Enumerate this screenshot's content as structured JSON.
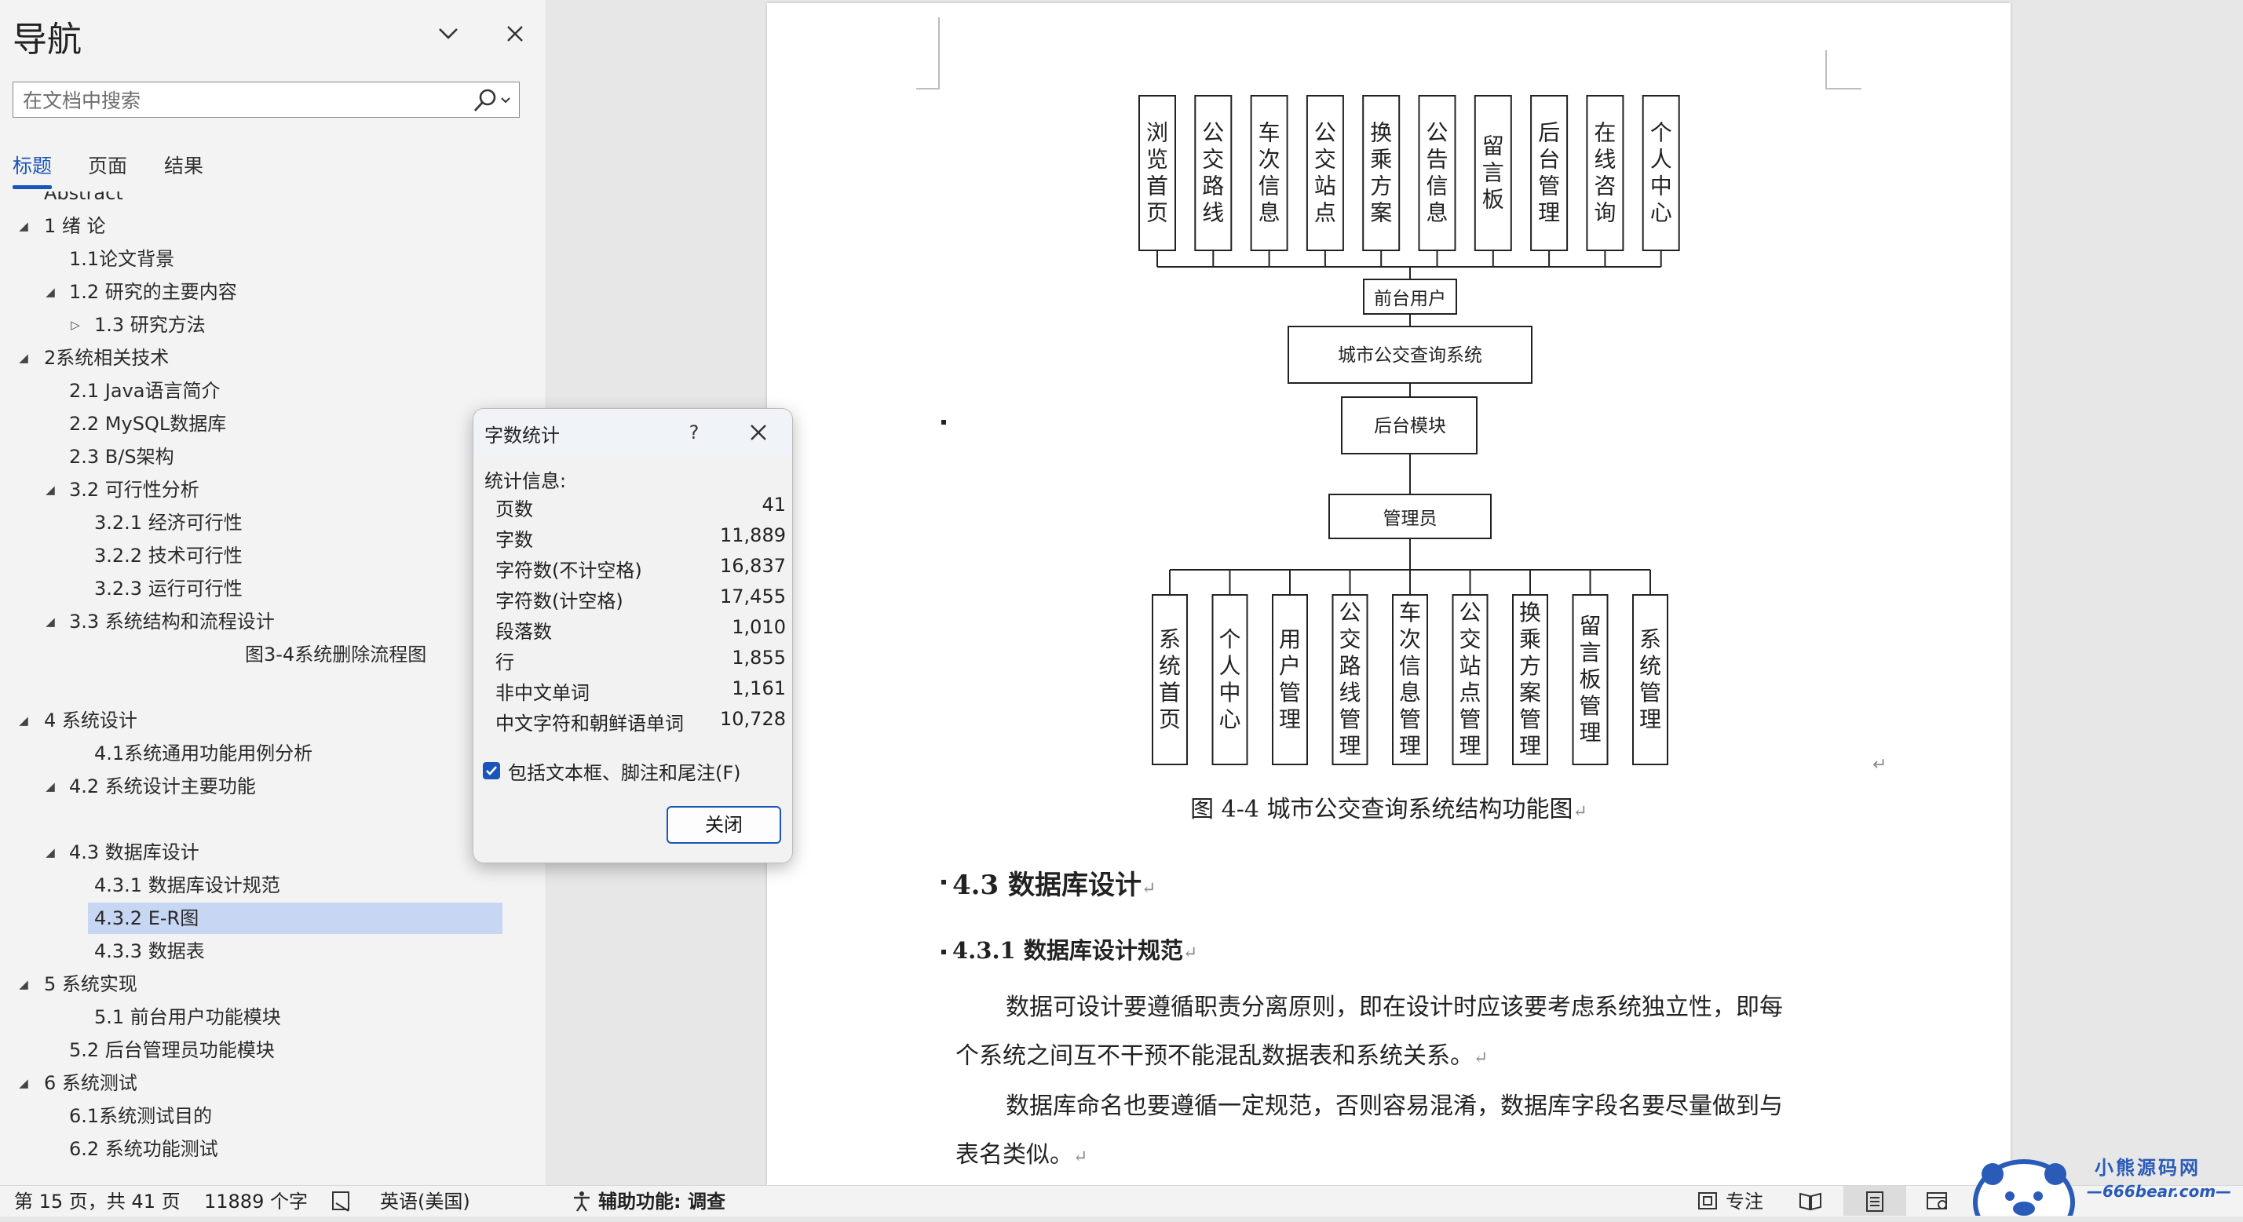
{
  "nav": {
    "title": "导航",
    "search_placeholder": "在文档中搜索",
    "tabs": [
      "标题",
      "页面",
      "结果"
    ],
    "items": [
      {
        "label": "Abstract",
        "level": 1,
        "arrow": ""
      },
      {
        "label": "1 绪  论",
        "level": 1,
        "arrow": "expanded"
      },
      {
        "label": "1.1论文背景",
        "level": 2,
        "arrow": ""
      },
      {
        "label": "1.2 研究的主要内容",
        "level": 2,
        "arrow": "expanded"
      },
      {
        "label": "1.3 研究方法",
        "level": 3,
        "arrow": "collapsed"
      },
      {
        "label": "2系统相关技术",
        "level": 1,
        "arrow": "expanded"
      },
      {
        "label": "2.1 Java语言简介",
        "level": 2,
        "arrow": ""
      },
      {
        "label": "2.2  MySQL数据库",
        "level": 2,
        "arrow": ""
      },
      {
        "label": "2.3 B/S架构",
        "level": 2,
        "arrow": ""
      },
      {
        "label": "3.2 可行性分析",
        "level": 2,
        "arrow": "expanded"
      },
      {
        "label": "3.2.1 经济可行性",
        "level": 3,
        "arrow": ""
      },
      {
        "label": "3.2.2 技术可行性",
        "level": 3,
        "arrow": ""
      },
      {
        "label": "3.2.3 运行可行性",
        "level": 3,
        "arrow": ""
      },
      {
        "label": "3.3 系统结构和流程设计",
        "level": 2,
        "arrow": "expanded"
      },
      {
        "label": "图3-4系统删除流程图",
        "level": 6,
        "arrow": ""
      },
      {
        "label": "",
        "level": 1,
        "arrow": ""
      },
      {
        "label": "4 系统设计",
        "level": 1,
        "arrow": "expanded"
      },
      {
        "label": "4.1系统通用功能用例分析",
        "level": 3,
        "arrow": ""
      },
      {
        "label": "4.2 系统设计主要功能",
        "level": 2,
        "arrow": "expanded"
      },
      {
        "label": "",
        "level": 1,
        "arrow": ""
      },
      {
        "label": "4.3 数据库设计",
        "level": 2,
        "arrow": "expanded"
      },
      {
        "label": "4.3.1 数据库设计规范",
        "level": 3,
        "arrow": ""
      },
      {
        "label": "4.3.2 E-R图",
        "level": 3,
        "arrow": "",
        "selected": true
      },
      {
        "label": "4.3.3 数据表",
        "level": 3,
        "arrow": ""
      },
      {
        "label": "5 系统实现",
        "level": 1,
        "arrow": "expanded"
      },
      {
        "label": "5.1 前台用户功能模块",
        "level": 3,
        "arrow": ""
      },
      {
        "label": "5.2 后台管理员功能模块",
        "level": 2,
        "arrow": ""
      },
      {
        "label": "6 系统测试",
        "level": 1,
        "arrow": "expanded"
      },
      {
        "label": "6.1系统测试目的",
        "level": 2,
        "arrow": ""
      },
      {
        "label": "6.2 系统功能测试",
        "level": 2,
        "arrow": ""
      }
    ]
  },
  "dialog": {
    "title": "字数统计",
    "help": "?",
    "section": "统计信息:",
    "stats": [
      {
        "label": "页数",
        "value": "41"
      },
      {
        "label": "字数",
        "value": "11,889"
      },
      {
        "label": "字符数(不计空格)",
        "value": "16,837"
      },
      {
        "label": "字符数(计空格)",
        "value": "17,455"
      },
      {
        "label": "段落数",
        "value": "1,010"
      },
      {
        "label": "行",
        "value": "1,855"
      },
      {
        "label": "非中文单词",
        "value": "1,161"
      },
      {
        "label": "中文字符和朝鲜语单词",
        "value": "10,728"
      }
    ],
    "checkbox_label": "包括文本框、脚注和尾注(F)",
    "checkbox_checked": true,
    "close_label": "关闭"
  },
  "document": {
    "diagram": {
      "top_boxes": [
        "浏览首页",
        "公交路线",
        "车次信息",
        "公交站点",
        "换乘方案",
        "公告信息",
        "留言板",
        "后台管理",
        "在线咨询",
        "个人中心"
      ],
      "front_user": "前台用户",
      "system": "城市公交查询系统",
      "backend": "后台模块",
      "admin": "管理员",
      "bottom_boxes": [
        "系统首页",
        "个人中心",
        "用户管理",
        "公交路线管理",
        "车次信息管理",
        "公交站点管理",
        "换乘方案管理",
        "留言板管理",
        "系统管理"
      ]
    },
    "caption": "图 4-4 城市公交查询系统结构功能图",
    "heading_43": "4.3  数据库设计",
    "heading_431": "4.3.1  数据库设计规范",
    "para1_line1": "数据可设计要遵循职责分离原则，即在设计时应该要考虑系统独立性，即每",
    "para1_line2": "个系统之间互不干预不能混乱数据表和系统关系。",
    "para2_line1": "数据库命名也要遵循一定规范，否则容易混淆，数据库字段名要尽量做到与",
    "para2_line2": "表名类似。",
    "return_mark": "↵"
  },
  "statusbar": {
    "page": "第 15 页，共 41 页",
    "words": "11889 个字",
    "language": "英语(美国)",
    "accessibility": "辅助功能: 调查",
    "focus": "专注"
  },
  "watermark": {
    "name": "小熊源码网",
    "url": "—666bear.com—"
  },
  "colors": {
    "accent": "#1a56b8",
    "selection": "#c7d6f2",
    "nav_bg": "#f3f3f3",
    "canvas_bg": "#e7e7e7"
  }
}
